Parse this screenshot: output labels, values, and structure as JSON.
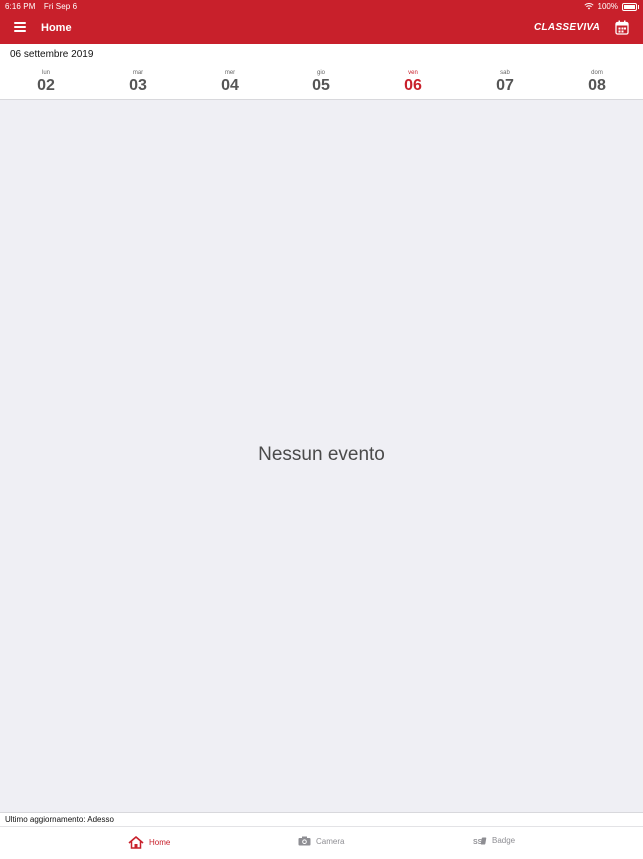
{
  "status_bar": {
    "time": "6:16 PM",
    "date": "Fri Sep 6",
    "battery": "100%"
  },
  "header": {
    "title": "Home",
    "logo": "CLASSEVIVA",
    "accent_color": "#c8202b"
  },
  "calendar": {
    "date_title": "06 settembre 2019",
    "days": [
      {
        "name": "lun",
        "num": "02"
      },
      {
        "name": "mar",
        "num": "03"
      },
      {
        "name": "mer",
        "num": "04"
      },
      {
        "name": "gio",
        "num": "05"
      },
      {
        "name": "ven",
        "num": "06",
        "selected": true
      },
      {
        "name": "sab",
        "num": "07"
      },
      {
        "name": "dom",
        "num": "08"
      }
    ]
  },
  "main": {
    "empty_text": "Nessun evento"
  },
  "footer": {
    "last_update": "Ultimo aggiornamento: Adesso"
  },
  "tabs": [
    {
      "label": "Home",
      "icon": "home-icon",
      "active": true
    },
    {
      "label": "Camera",
      "icon": "camera-icon"
    },
    {
      "label": "Badge",
      "icon": "badge-icon"
    }
  ]
}
